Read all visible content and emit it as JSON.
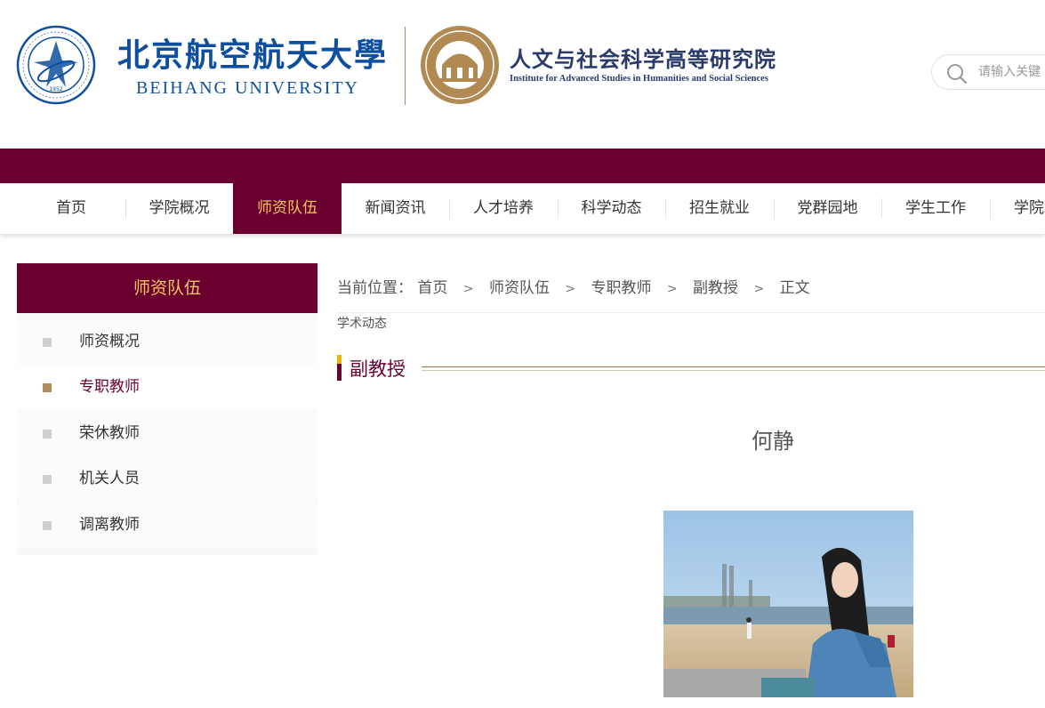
{
  "header": {
    "university_cn": "北京航空航天大學",
    "university_en": "BEIHANG UNIVERSITY",
    "seal_year": "1952",
    "institute_cn": "人文与社会科学高等研究院",
    "institute_en": "Institute for Advanced Studies in Humanities and Social Sciences",
    "search_placeholder": "请输入关键"
  },
  "nav": {
    "items": [
      {
        "label": "首页"
      },
      {
        "label": "学院概况"
      },
      {
        "label": "师资队伍",
        "active": true
      },
      {
        "label": "新闻资讯"
      },
      {
        "label": "人才培养"
      },
      {
        "label": "科学动态"
      },
      {
        "label": "招生就业"
      },
      {
        "label": "党群园地"
      },
      {
        "label": "学生工作"
      },
      {
        "label": "学院"
      }
    ]
  },
  "sidebar": {
    "title": "师资队伍",
    "items": [
      {
        "label": "师资概况"
      },
      {
        "label": "专职教师",
        "active": true
      },
      {
        "label": "荣休教师"
      },
      {
        "label": "机关人员"
      },
      {
        "label": "调离教师"
      }
    ]
  },
  "breadcrumb": {
    "prefix": "当前位置：",
    "items": [
      "首页",
      "师资队伍",
      "专职教师",
      "副教授",
      "正文"
    ],
    "sub": "学术动态"
  },
  "section": {
    "title": "副教授"
  },
  "article": {
    "name": "何静"
  },
  "colors": {
    "maroon": "#6a0030",
    "gold": "#f4c75a",
    "accent_yellow": "#f0b400",
    "brand_blue": "#0d4f9e",
    "bullet_active": "#b28c5c",
    "bullet_inactive": "#cfcfcf"
  }
}
